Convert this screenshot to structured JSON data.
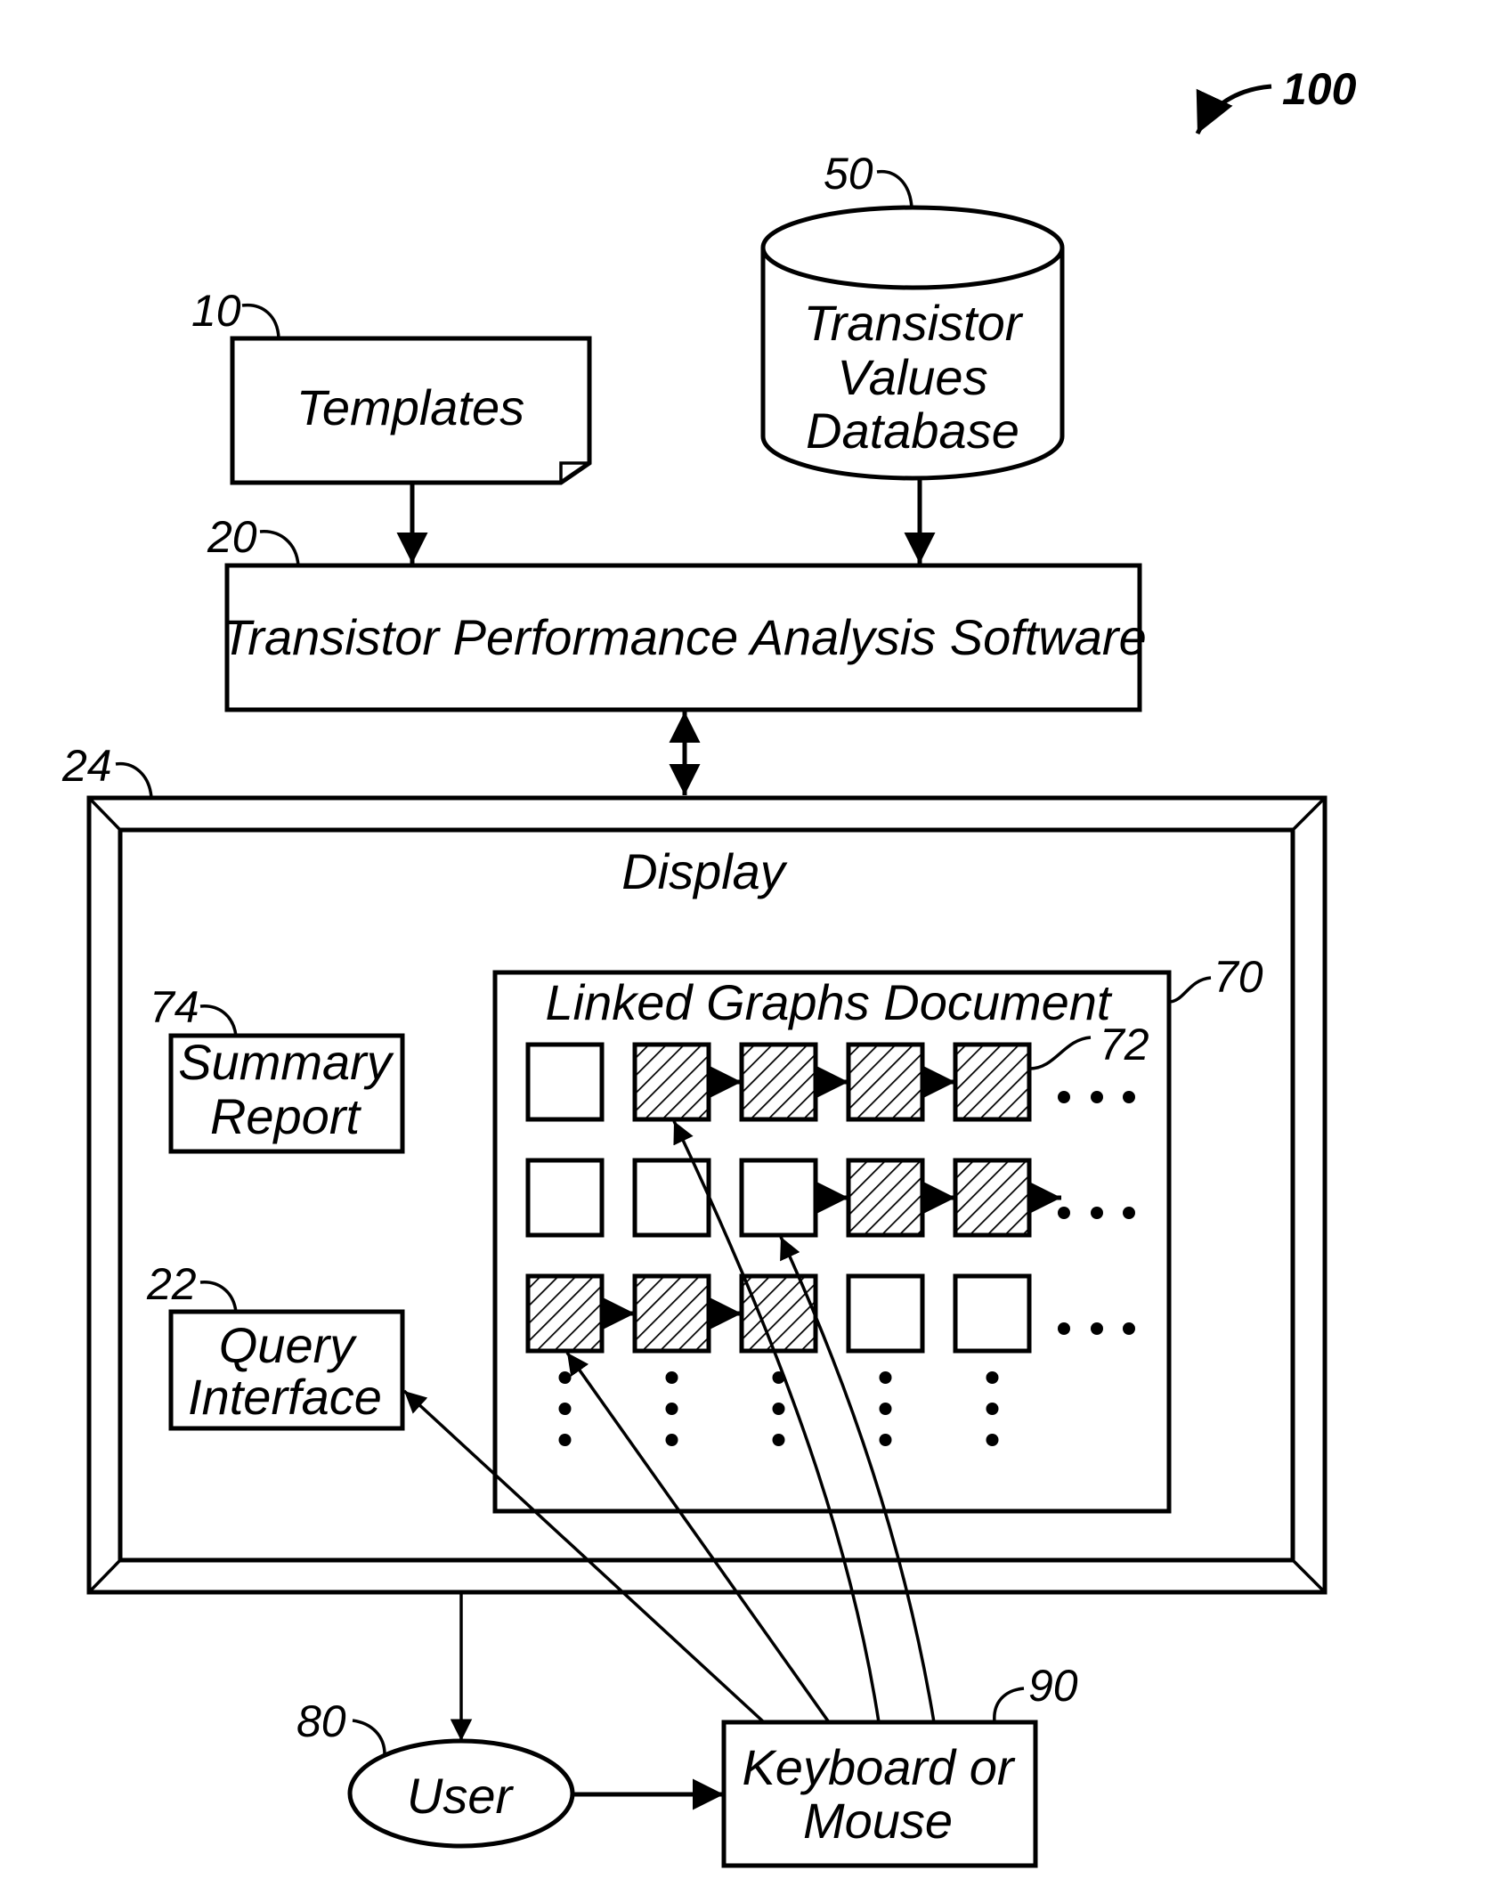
{
  "figure": {
    "ref_number": "100",
    "templates": {
      "ref": "10",
      "label": "Templates"
    },
    "database": {
      "ref": "50",
      "lines": [
        "Transistor",
        "Values",
        "Database"
      ]
    },
    "software": {
      "ref": "20",
      "label": "Transistor Performance Analysis Software"
    },
    "display": {
      "ref": "24",
      "label": "Display"
    },
    "summary_report": {
      "ref": "74",
      "lines": [
        "Summary",
        "Report"
      ]
    },
    "query_interface": {
      "ref": "22",
      "lines": [
        "Query",
        "Interface"
      ]
    },
    "linked_graphs": {
      "ref": "70",
      "label": "Linked Graphs Document",
      "graph_ref": "72",
      "grid": [
        [
          false,
          true,
          true,
          true,
          true
        ],
        [
          false,
          false,
          false,
          true,
          true
        ],
        [
          true,
          true,
          true,
          false,
          false
        ]
      ],
      "links": [
        [
          [
            1,
            2
          ],
          [
            2,
            3
          ],
          [
            3,
            4
          ]
        ],
        [
          [
            2,
            3
          ],
          [
            3,
            4
          ],
          [
            4,
            "more"
          ]
        ],
        [
          [
            0,
            1
          ],
          [
            1,
            2
          ]
        ]
      ]
    },
    "user": {
      "ref": "80",
      "label": "User"
    },
    "input_device": {
      "ref": "90",
      "lines": [
        "Keyboard or",
        "Mouse"
      ]
    }
  }
}
